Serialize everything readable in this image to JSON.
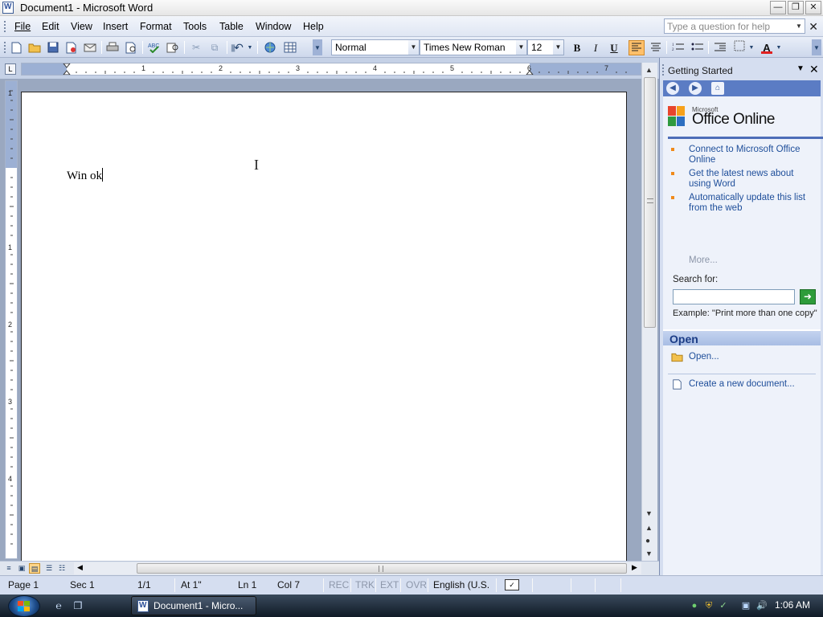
{
  "window": {
    "title": "Document1 - Microsoft Word",
    "icon": "word-icon",
    "controls": [
      "minimize",
      "restore",
      "close"
    ]
  },
  "menubar": {
    "items": [
      {
        "label": "File",
        "mnemonic": "F"
      },
      {
        "label": "Edit",
        "mnemonic": "E"
      },
      {
        "label": "View",
        "mnemonic": "V"
      },
      {
        "label": "Insert",
        "mnemonic": "I"
      },
      {
        "label": "Format",
        "mnemonic": "o"
      },
      {
        "label": "Tools",
        "mnemonic": "T"
      },
      {
        "label": "Table",
        "mnemonic": "a"
      },
      {
        "label": "Window",
        "mnemonic": "W"
      },
      {
        "label": "Help",
        "mnemonic": "H"
      }
    ],
    "help_placeholder": "Type a question for help"
  },
  "toolbar": {
    "style": "Normal",
    "font": "Times New Roman",
    "size": "12",
    "bold": "B",
    "italic": "I",
    "underline": "U",
    "font_color": "#e02020",
    "active_alignment": "align-left"
  },
  "ruler": {
    "h_numbers": [
      "1",
      "2",
      "3",
      "4",
      "5",
      "6",
      "7"
    ],
    "v_numbers": [
      "1",
      "1",
      "2",
      "3",
      "4"
    ],
    "tab_selector": "L"
  },
  "document": {
    "text": "Win ok"
  },
  "taskpane": {
    "title": "Getting Started",
    "logo_microsoft": "Microsoft",
    "logo_text": "Office Online",
    "links": [
      "Connect to Microsoft Office Online",
      "Get the latest news about using Word",
      "Automatically update this list from the web"
    ],
    "more": "More...",
    "search_label": "Search for:",
    "search_value": "",
    "example": "Example:  \"Print more than one copy\"",
    "open_title": "Open",
    "open_link": "Open...",
    "new_link": "Create a new document..."
  },
  "statusbar": {
    "page": "Page 1",
    "sec": "Sec 1",
    "pages": "1/1",
    "at": "At 1\"",
    "ln": "Ln 1",
    "col": "Col 7",
    "rec": "REC",
    "trk": "TRK",
    "ext": "EXT",
    "ovr": "OVR",
    "language": "English (U.S."
  },
  "taskbar": {
    "task_label": "Document1 - Micro...",
    "clock": "1:06 AM"
  },
  "colors": {
    "titlebar": "#f0f0f0",
    "menubar": "#e4eaf6",
    "toolbar": "#d6e0f2",
    "taskpane_link": "#1e4e9a",
    "active_button": "#ffc06b",
    "taskbar": "#1a2533"
  }
}
